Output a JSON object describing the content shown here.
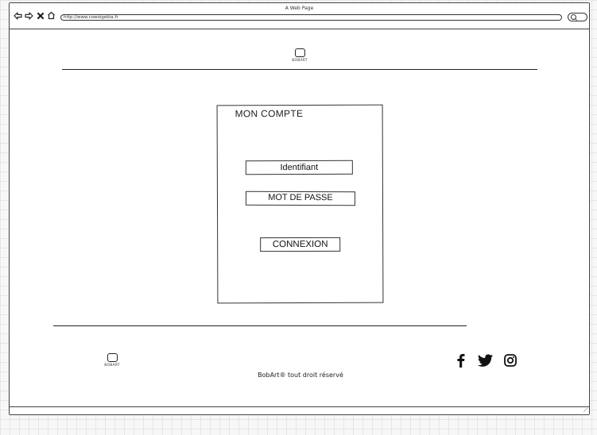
{
  "window": {
    "title": "A Web Page",
    "url": "http://www.cowoigebia.fr"
  },
  "header": {
    "logo_icon": "square-logo-icon",
    "logo_label": "BOBART"
  },
  "account": {
    "title": "MON COMPTE",
    "identifier_label": "Identifiant",
    "password_label": "MOT DE PASSE",
    "connect_label": "CONNEXION"
  },
  "footer": {
    "logo_icon": "square-logo-icon",
    "logo_label": "BOBART",
    "copyright": "BobArt® tout droit réservé",
    "social_icons": [
      "facebook-icon",
      "twitter-icon",
      "instagram-icon"
    ]
  },
  "colors": {
    "stroke": "#222222",
    "background": "#ffffff",
    "grid": "#e6e6e6"
  }
}
